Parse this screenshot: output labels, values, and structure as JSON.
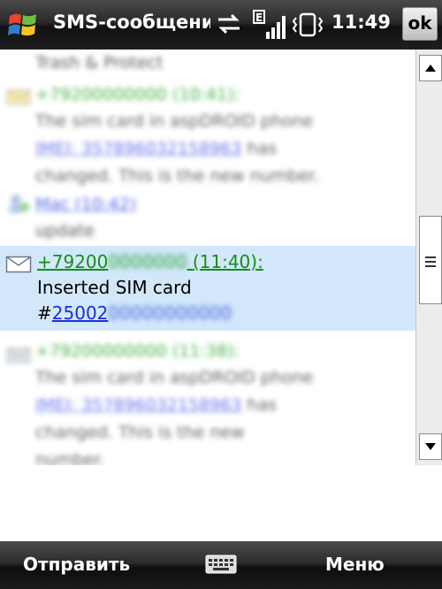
{
  "titlebar": {
    "app_title": "SMS-сообщени",
    "time": "11:49",
    "ok_label": "ok",
    "icons": [
      "windows-start-icon",
      "sync-arrows-icon",
      "signal-edge-icon",
      "vibrate-icon"
    ]
  },
  "messages": {
    "selected": {
      "sender_prefix": "+79200",
      "sender_masked": "0000000",
      "time": "(11:40):",
      "line1": "Inserted SIM card",
      "line2_prefix": "#",
      "line2_link": "25002",
      "line2_masked": "00000000000",
      "icon": "envelope-icon"
    },
    "blurred": {
      "fragment_top": "Trash & Protect",
      "msg1_header": "+79200000000 (10:41):",
      "msg1_body_a": "The sim card in aspDROID phone",
      "msg1_body_link": "IMEI: 357896032158963",
      "msg1_body_b": "has",
      "msg1_body_c": "changed. This is the new number.",
      "msg2_header": "Mac (10:42)",
      "msg2_body": "update",
      "msg3_header": "+79200000000 (11:38):",
      "msg3_body_a": "The sim card in aspDROID phone",
      "msg3_body_link": "IMEI: 357896032158963",
      "msg3_body_b": "has",
      "msg3_body_c": "changed. This is the new",
      "msg3_body_d": "number."
    }
  },
  "menubar": {
    "left_label": "Отправить",
    "right_label": "Меню",
    "center_icon": "keyboard-icon"
  },
  "colors": {
    "selection_bg": "#d2e7fa",
    "sender_green": "#159015",
    "link_blue": "#1a30d8"
  }
}
